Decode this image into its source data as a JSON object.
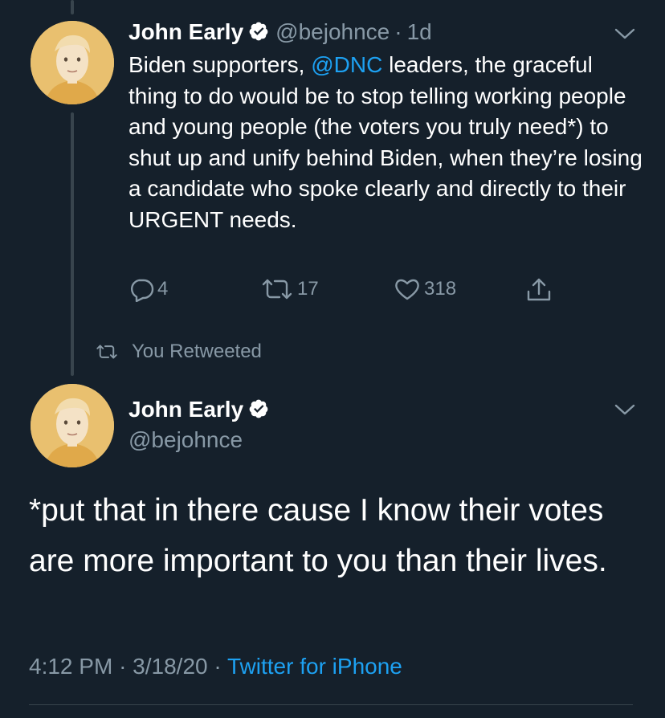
{
  "tweet1": {
    "name": "John Early",
    "handle": "@bejohnce",
    "sep": "·",
    "time": "1d",
    "text_before_mention": "Biden supporters, ",
    "mention": "@DNC",
    "text_after_mention": " leaders, the graceful thing to do would be to stop telling working people and young people (the voters you truly need*) to shut up and unify behind Biden, when they’re losing a candidate who spoke clearly and directly to their URGENT needs.",
    "replies": "4",
    "retweets": "17",
    "likes": "318"
  },
  "retweet_label": "You Retweeted",
  "tweet2": {
    "name": "John Early",
    "handle": "@bejohnce",
    "text": "*put that in there cause I know their votes are more important to you than their lives.",
    "time": "4:12 PM",
    "sep": "·",
    "date": "3/18/20",
    "sep2": "·",
    "source": "Twitter for iPhone"
  },
  "colors": {
    "background": "#15202b",
    "link": "#1da1f2",
    "muted": "#8899a6"
  },
  "icons": [
    "verified-badge-icon",
    "chevron-down-icon",
    "reply-icon",
    "retweet-icon",
    "like-icon",
    "share-icon"
  ]
}
